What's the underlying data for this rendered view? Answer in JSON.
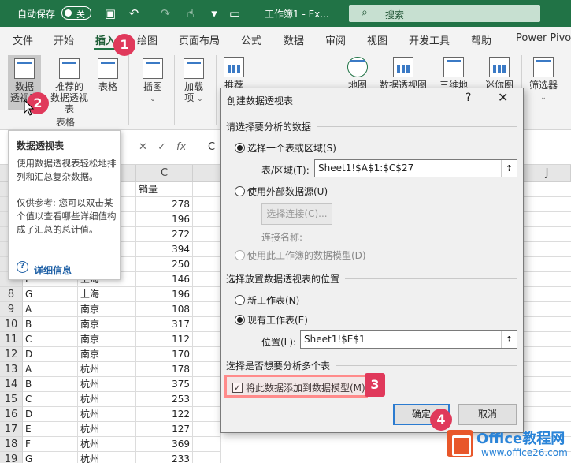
{
  "titlebar": {
    "autosave_label": "自动保存",
    "autosave_state": "关",
    "doc_title": "工作簿1 - Ex...",
    "search_label": "搜索"
  },
  "tabs": [
    "文件",
    "开始",
    "插入",
    "绘图",
    "页面布局",
    "公式",
    "数据",
    "审阅",
    "视图",
    "开发工具",
    "帮助",
    "Power Pivot"
  ],
  "active_tab": "插入",
  "ribbon": {
    "pivot_table": "数据\n透视表",
    "recommended_pivot": "推荐的\n数据透视表",
    "table": "表格",
    "group_tables": "表格",
    "illustrations": "插图",
    "addins": "加载\n项",
    "rec_charts": "推荐的",
    "maps": "地图",
    "pivot_chart": "数据透视图",
    "threed": "三维地",
    "sparkline": "迷你图",
    "filter": "筛选器"
  },
  "tooltip": {
    "title": "数据透视表",
    "desc1": "使用数据透视表轻松地排列和汇总复杂数据。",
    "desc2": "仅供参考: 您可以双击某个值以查看哪些详细值构成了汇总的总计值。",
    "more": "详细信息"
  },
  "formula_bar": {
    "fx": "fx",
    "cell_preview": "C"
  },
  "grid": {
    "col_c": "C",
    "col_j": "J",
    "header_c": "销量",
    "rows": [
      {
        "n": "",
        "a": "",
        "b": "",
        "c": "278"
      },
      {
        "n": "",
        "a": "",
        "b": "",
        "c": "196"
      },
      {
        "n": "",
        "a": "",
        "b": "",
        "c": "272"
      },
      {
        "n": "",
        "a": "",
        "b": "",
        "c": "394"
      },
      {
        "n": "",
        "a": "",
        "b": "",
        "c": "250"
      },
      {
        "n": "",
        "a": "F",
        "b": "上海",
        "c": "146"
      },
      {
        "n": "8",
        "a": "G",
        "b": "上海",
        "c": "196"
      },
      {
        "n": "9",
        "a": "A",
        "b": "南京",
        "c": "108"
      },
      {
        "n": "10",
        "a": "B",
        "b": "南京",
        "c": "317"
      },
      {
        "n": "11",
        "a": "C",
        "b": "南京",
        "c": "112"
      },
      {
        "n": "12",
        "a": "D",
        "b": "南京",
        "c": "170"
      },
      {
        "n": "13",
        "a": "A",
        "b": "杭州",
        "c": "178"
      },
      {
        "n": "14",
        "a": "B",
        "b": "杭州",
        "c": "375"
      },
      {
        "n": "15",
        "a": "C",
        "b": "杭州",
        "c": "253"
      },
      {
        "n": "16",
        "a": "D",
        "b": "杭州",
        "c": "122"
      },
      {
        "n": "17",
        "a": "E",
        "b": "杭州",
        "c": "127"
      },
      {
        "n": "18",
        "a": "F",
        "b": "杭州",
        "c": "369"
      },
      {
        "n": "19",
        "a": "G",
        "b": "杭州",
        "c": "233"
      }
    ]
  },
  "dialog": {
    "title": "创建数据透视表",
    "help": "?",
    "close": "✕",
    "section1": "请选择要分析的数据",
    "opt_table": "选择一个表或区域(S)",
    "range_label": "表/区域(T):",
    "range_value": "Sheet1!$A$1:$C$27",
    "opt_external": "使用外部数据源(U)",
    "choose_conn": "选择连接(C)...",
    "conn_name": "连接名称:",
    "opt_model": "使用此工作簿的数据模型(D)",
    "section2": "选择放置数据透视表的位置",
    "opt_new_sheet": "新工作表(N)",
    "opt_existing": "现有工作表(E)",
    "location_label": "位置(L):",
    "location_value": "Sheet1!$E$1",
    "section3": "选择是否想要分析多个表",
    "add_model": "将此数据添加到数据模型(M)",
    "ok": "确定",
    "cancel": "取消"
  },
  "badges": [
    "1",
    "2",
    "3",
    "4"
  ],
  "watermark": {
    "brand": "Office教程网",
    "url": "www.office26.com"
  }
}
